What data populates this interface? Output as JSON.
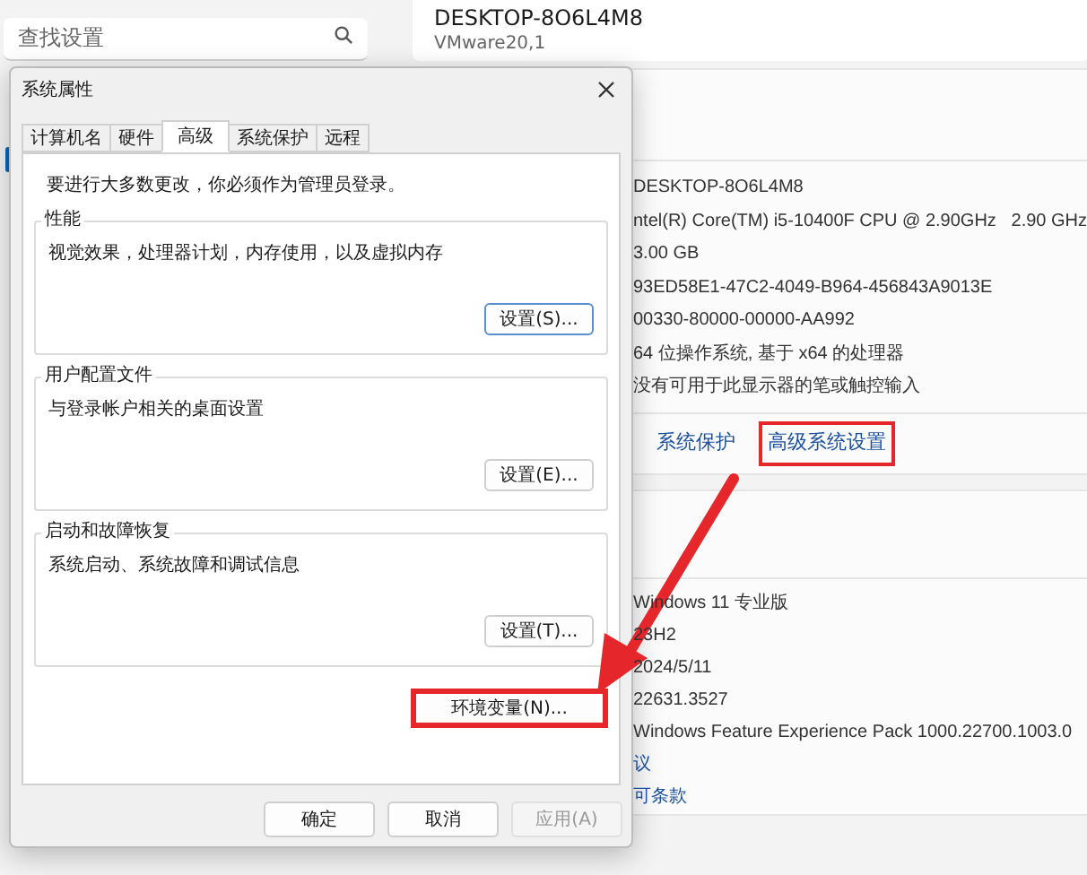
{
  "settings": {
    "search": {
      "placeholder": "查找设置"
    },
    "device": {
      "name": "DESKTOP-8O6L4M8",
      "model": "VMware20,1"
    },
    "specs": [
      "DESKTOP-8O6L4M8",
      "ntel(R) Core(TM) i5-10400F CPU @ 2.90GHz   2.90 GHz",
      "3.00 GB",
      "93ED58E1-47C2-4049-B964-456843A9013E",
      "00330-80000-00000-AA992",
      "64 位操作系统, 基于 x64 的处理器",
      "没有可用于此显示器的笔或触控输入"
    ],
    "links": [
      {
        "label": "系统保护",
        "annotated": false
      },
      {
        "label": "高级系统设置",
        "annotated": true
      }
    ],
    "windows_specs": [
      "Windows 11 专业版",
      "23H2",
      "2024/5/11",
      "22631.3527",
      "Windows Feature Experience Pack 1000.22700.1003.0"
    ],
    "footer_links": [
      "议",
      "可条款"
    ]
  },
  "dialog": {
    "title": "系统属性",
    "tabs": [
      {
        "label": "计算机名",
        "selected": false
      },
      {
        "label": "硬件",
        "selected": false
      },
      {
        "label": "高级",
        "selected": true
      },
      {
        "label": "系统保护",
        "selected": false
      },
      {
        "label": "远程",
        "selected": false
      }
    ],
    "notice": "要进行大多数更改，你必须作为管理员登录。",
    "groups": [
      {
        "title": "性能",
        "description": "视觉效果，处理器计划，内存使用，以及虚拟内存",
        "button": "设置(S)...",
        "focused": true
      },
      {
        "title": "用户配置文件",
        "description": "与登录帐户相关的桌面设置",
        "button": "设置(E)...",
        "focused": false
      },
      {
        "title": "启动和故障恢复",
        "description": "系统启动、系统故障和调试信息",
        "button": "设置(T)...",
        "focused": false
      }
    ],
    "env_button": {
      "label": "环境变量(N)...",
      "annotated": true
    },
    "buttons": [
      {
        "label": "确定",
        "disabled": false
      },
      {
        "label": "取消",
        "disabled": false
      },
      {
        "label": "应用(A)",
        "disabled": true
      }
    ]
  }
}
